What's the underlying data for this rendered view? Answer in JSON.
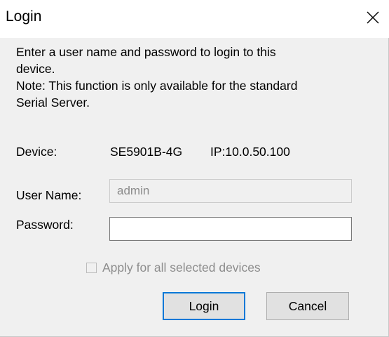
{
  "window": {
    "title": "Login",
    "close_icon": "close-icon"
  },
  "message": {
    "line1": "Enter a user name and password to login to this",
    "line2": "device.",
    "line3": "Note: This function is only available for the standard",
    "line4": "Serial Server."
  },
  "device": {
    "label": "Device:",
    "model": "SE5901B-4G",
    "ip": "IP:10.0.50.100"
  },
  "form": {
    "username_label": "User Name:",
    "username_value": "admin",
    "password_label": "Password:",
    "password_value": "",
    "apply_all_label": "Apply for all selected devices",
    "apply_all_checked": false,
    "apply_all_enabled": false
  },
  "buttons": {
    "login": "Login",
    "cancel": "Cancel"
  },
  "colors": {
    "dialog_bg": "#f0f0f0",
    "titlebar_bg": "#ffffff",
    "default_button_border": "#0078d7",
    "disabled_text": "#8d8d8d"
  }
}
